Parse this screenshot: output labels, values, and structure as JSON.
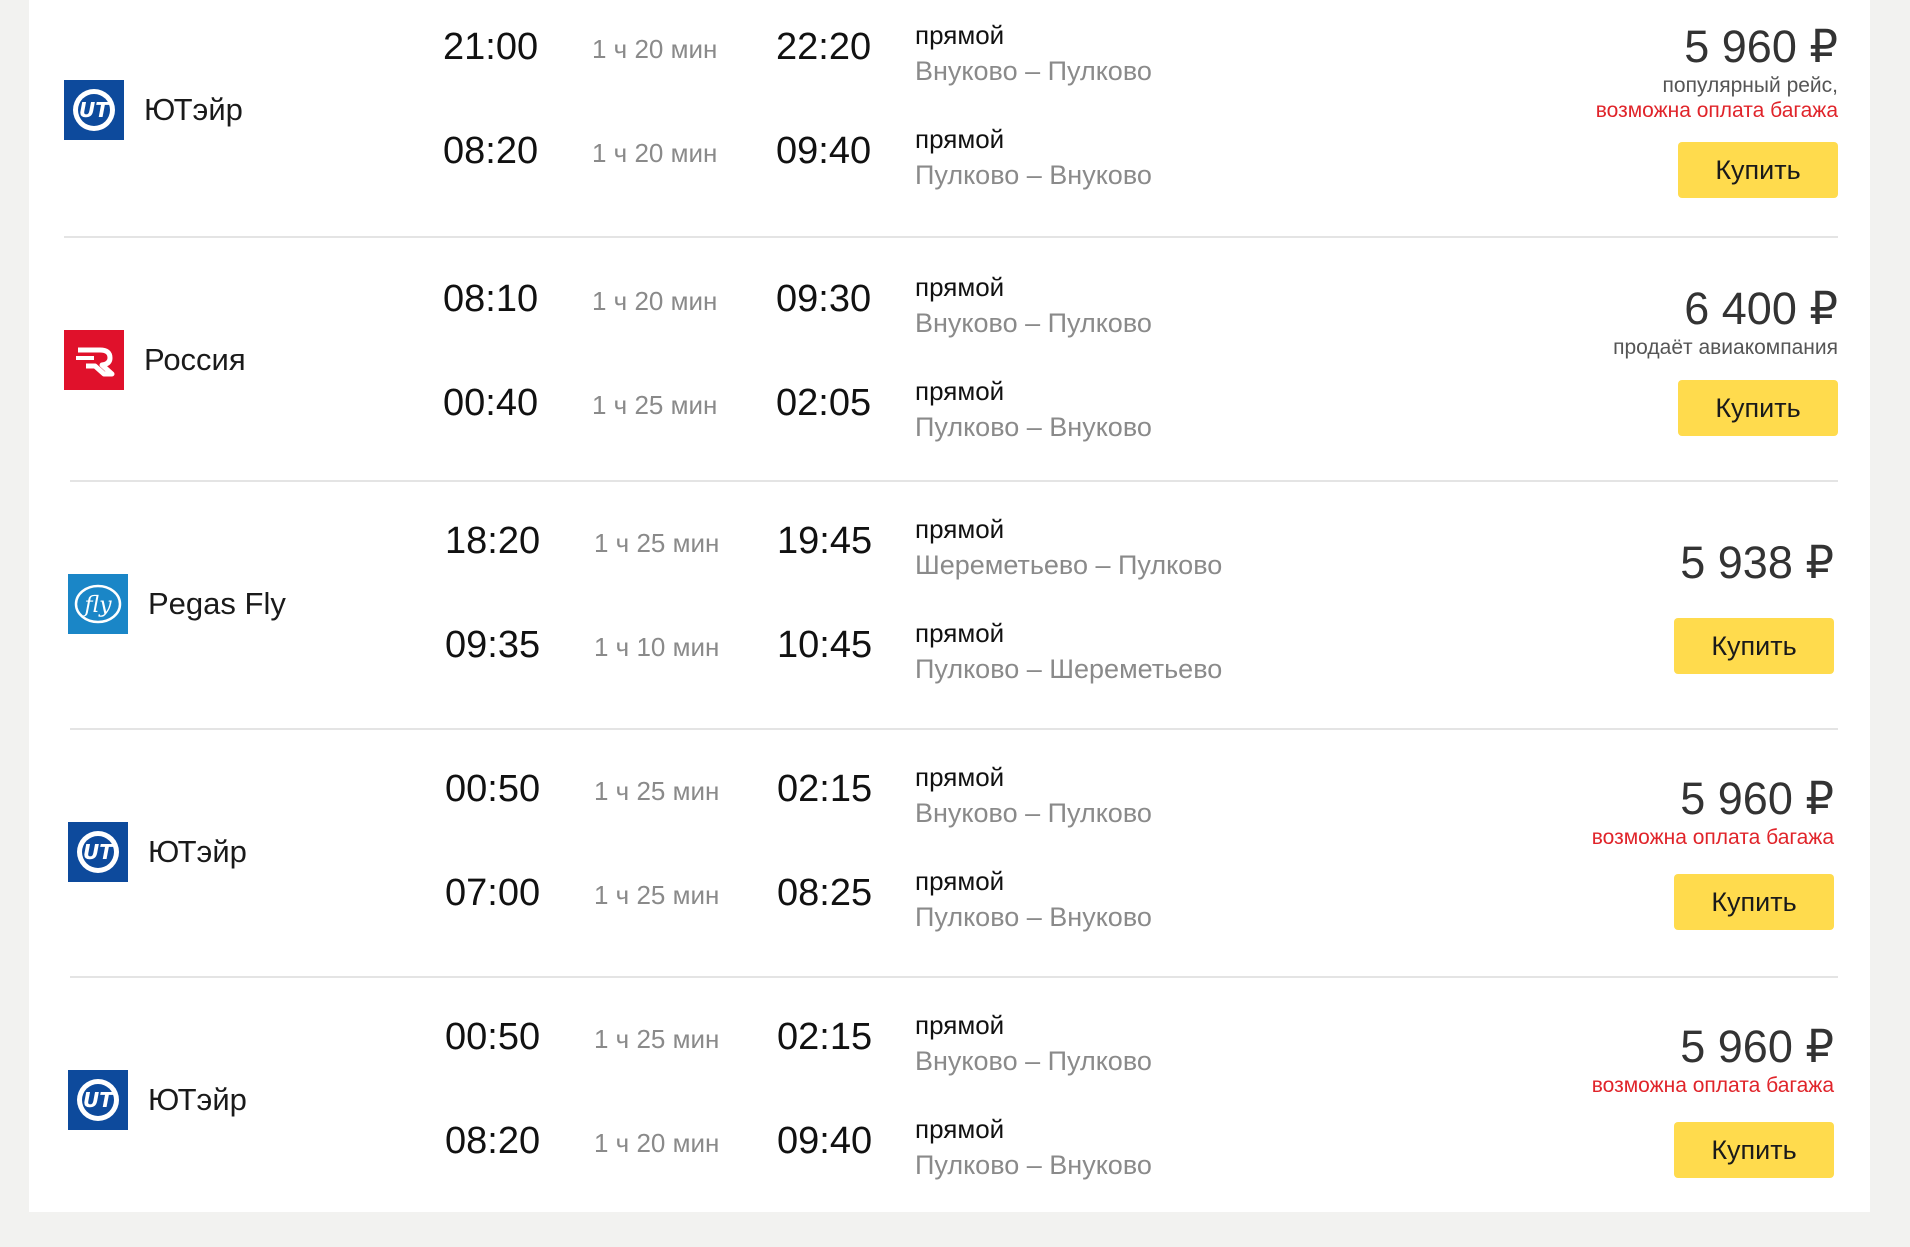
{
  "colors": {
    "buy_button": "#ffdb4d",
    "utair_blue": "#0d4a9c",
    "rossiya_red": "#e0112b",
    "pegas_blue": "#1a86c7",
    "baggage_warning": "#e0242a"
  },
  "flights": [
    {
      "airline": "ЮТэйр",
      "logo_icon": "utair-logo-icon",
      "price": "5 960 ₽",
      "notes": [
        "популярный рейс,"
      ],
      "warning": "возможна оплата багажа",
      "buy_label": "Купить",
      "legs": [
        {
          "depart": "21:00",
          "duration": "1 ч 20 мин",
          "arrive": "22:20",
          "stops": "прямой",
          "route": "Внуково – Пулково"
        },
        {
          "depart": "08:20",
          "duration": "1 ч 20 мин",
          "arrive": "09:40",
          "stops": "прямой",
          "route": "Пулково – Внуково"
        }
      ]
    },
    {
      "airline": "Россия",
      "logo_icon": "rossiya-logo-icon",
      "price": "6 400 ₽",
      "notes": [
        "продаёт авиакомпания"
      ],
      "warning": "",
      "buy_label": "Купить",
      "legs": [
        {
          "depart": "08:10",
          "duration": "1 ч 20 мин",
          "arrive": "09:30",
          "stops": "прямой",
          "route": "Внуково – Пулково"
        },
        {
          "depart": "00:40",
          "duration": "1 ч 25 мин",
          "arrive": "02:05",
          "stops": "прямой",
          "route": "Пулково – Внуково"
        }
      ]
    },
    {
      "airline": "Pegas Fly",
      "logo_icon": "pegas-fly-logo-icon",
      "price": "5 938 ₽",
      "notes": [],
      "warning": "",
      "buy_label": "Купить",
      "legs": [
        {
          "depart": "18:20",
          "duration": "1 ч 25 мин",
          "arrive": "19:45",
          "stops": "прямой",
          "route": "Шереметьево – Пулково"
        },
        {
          "depart": "09:35",
          "duration": "1 ч 10 мин",
          "arrive": "10:45",
          "stops": "прямой",
          "route": "Пулково – Шереметьево"
        }
      ]
    },
    {
      "airline": "ЮТэйр",
      "logo_icon": "utair-logo-icon",
      "price": "5 960 ₽",
      "notes": [],
      "warning": "возможна оплата багажа",
      "buy_label": "Купить",
      "legs": [
        {
          "depart": "00:50",
          "duration": "1 ч 25 мин",
          "arrive": "02:15",
          "stops": "прямой",
          "route": "Внуково – Пулково"
        },
        {
          "depart": "07:00",
          "duration": "1 ч 25 мин",
          "arrive": "08:25",
          "stops": "прямой",
          "route": "Пулково – Внуково"
        }
      ]
    },
    {
      "airline": "ЮТэйр",
      "logo_icon": "utair-logo-icon",
      "price": "5 960 ₽",
      "notes": [],
      "warning": "возможна оплата багажа",
      "buy_label": "Купить",
      "legs": [
        {
          "depart": "00:50",
          "duration": "1 ч 25 мин",
          "arrive": "02:15",
          "stops": "прямой",
          "route": "Внуково – Пулково"
        },
        {
          "depart": "08:20",
          "duration": "1 ч 20 мин",
          "arrive": "09:40",
          "stops": "прямой",
          "route": "Пулково – Внуково"
        }
      ]
    }
  ]
}
